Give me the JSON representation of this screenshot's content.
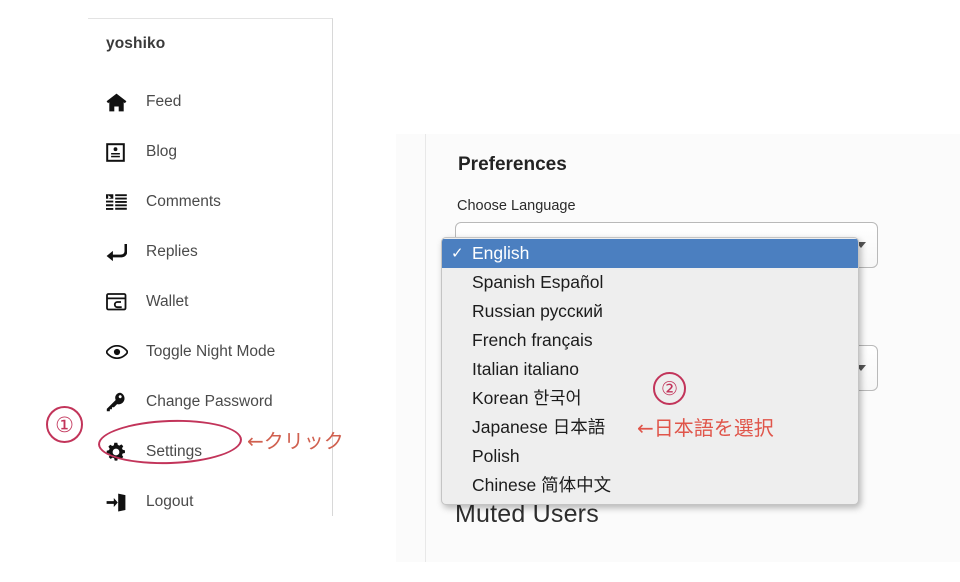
{
  "sidebar": {
    "username": "yoshiko",
    "items": [
      {
        "label": "Feed",
        "icon": "home-icon"
      },
      {
        "label": "Blog",
        "icon": "id-card-icon"
      },
      {
        "label": "Comments",
        "icon": "comments-list-icon"
      },
      {
        "label": "Replies",
        "icon": "reply-arrow-icon"
      },
      {
        "label": "Wallet",
        "icon": "wallet-icon"
      },
      {
        "label": "Toggle Night Mode",
        "icon": "eye-icon"
      },
      {
        "label": "Change Password",
        "icon": "key-icon"
      },
      {
        "label": "Settings",
        "icon": "gear-icon"
      },
      {
        "label": "Logout",
        "icon": "logout-door-icon"
      }
    ]
  },
  "preferences": {
    "title": "Preferences",
    "choose_language_label": "Choose Language",
    "muted_users_title": "Muted Users",
    "language_select_value": "English",
    "second_select_value": ""
  },
  "language_dropdown": {
    "check_glyph": "✓",
    "selected": "English",
    "options": [
      "English",
      "Spanish Español",
      "Russian русский",
      "French français",
      "Italian italiano",
      "Korean 한국어",
      "Japanese 日本語",
      "Polish",
      "Chinese 简体中文"
    ]
  },
  "annotations": {
    "step_one_badge": "①",
    "step_two_badge": "②",
    "click_hint": "←クリック",
    "select_japanese_hint": "←日本語を選択"
  },
  "colors": {
    "annotation_circle": "#c2345a",
    "annotation_text": "#d0604f",
    "dropdown_highlight": "#4b7fc0",
    "panel_background": "#fbfbfb"
  }
}
